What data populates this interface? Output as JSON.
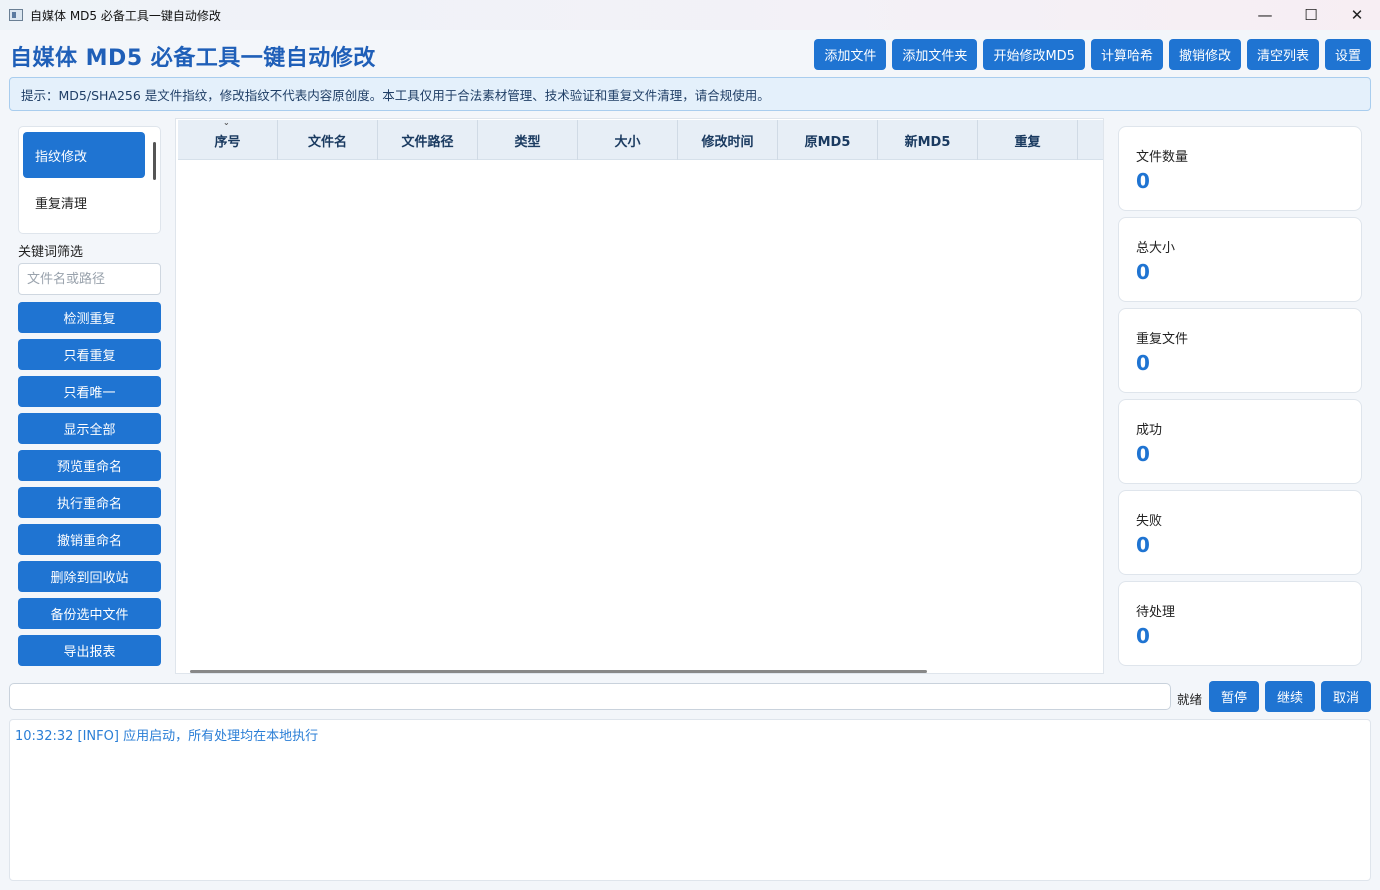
{
  "window": {
    "title": "自媒体 MD5 必备工具一键自动修改",
    "minimize": "—",
    "maximize": "☐",
    "close": "✕"
  },
  "header": {
    "title": "自媒体 MD5 必备工具一键自动修改",
    "buttons": [
      "添加文件",
      "添加文件夹",
      "开始修改MD5",
      "计算哈希",
      "撤销修改",
      "清空列表",
      "设置"
    ]
  },
  "hint": "提示：MD5/SHA256 是文件指纹，修改指纹不代表内容原创度。本工具仅用于合法素材管理、技术验证和重复文件清理，请合规使用。",
  "sidebar": {
    "modes": [
      {
        "label": "指纹修改",
        "active": true
      },
      {
        "label": "重复清理",
        "active": false
      }
    ],
    "filter_label": "关键词筛选",
    "filter_placeholder": "文件名或路径",
    "filter_value": "",
    "buttons": [
      "检测重复",
      "只看重复",
      "只看唯一",
      "显示全部",
      "预览重命名",
      "执行重命名",
      "撤销重命名",
      "删除到回收站",
      "备份选中文件",
      "导出报表"
    ]
  },
  "table": {
    "columns": [
      "序号",
      "文件名",
      "文件路径",
      "类型",
      "大小",
      "修改时间",
      "原MD5",
      "新MD5",
      "重复"
    ],
    "sort_indicator": "⌄",
    "rows": []
  },
  "stats": [
    {
      "label": "文件数量",
      "value": "0"
    },
    {
      "label": "总大小",
      "value": "0"
    },
    {
      "label": "重复文件",
      "value": "0"
    },
    {
      "label": "成功",
      "value": "0"
    },
    {
      "label": "失败",
      "value": "0"
    },
    {
      "label": "待处理",
      "value": "0"
    }
  ],
  "progress": {
    "value": 0,
    "status": "就绪"
  },
  "controls": [
    "暂停",
    "继续",
    "取消"
  ],
  "log": [
    "10:32:32 [INFO] 应用启动，所有处理均在本地执行"
  ],
  "colors": {
    "accent": "#1f74d2",
    "title": "#1f5fb8",
    "log_text": "#2a7ed6"
  }
}
